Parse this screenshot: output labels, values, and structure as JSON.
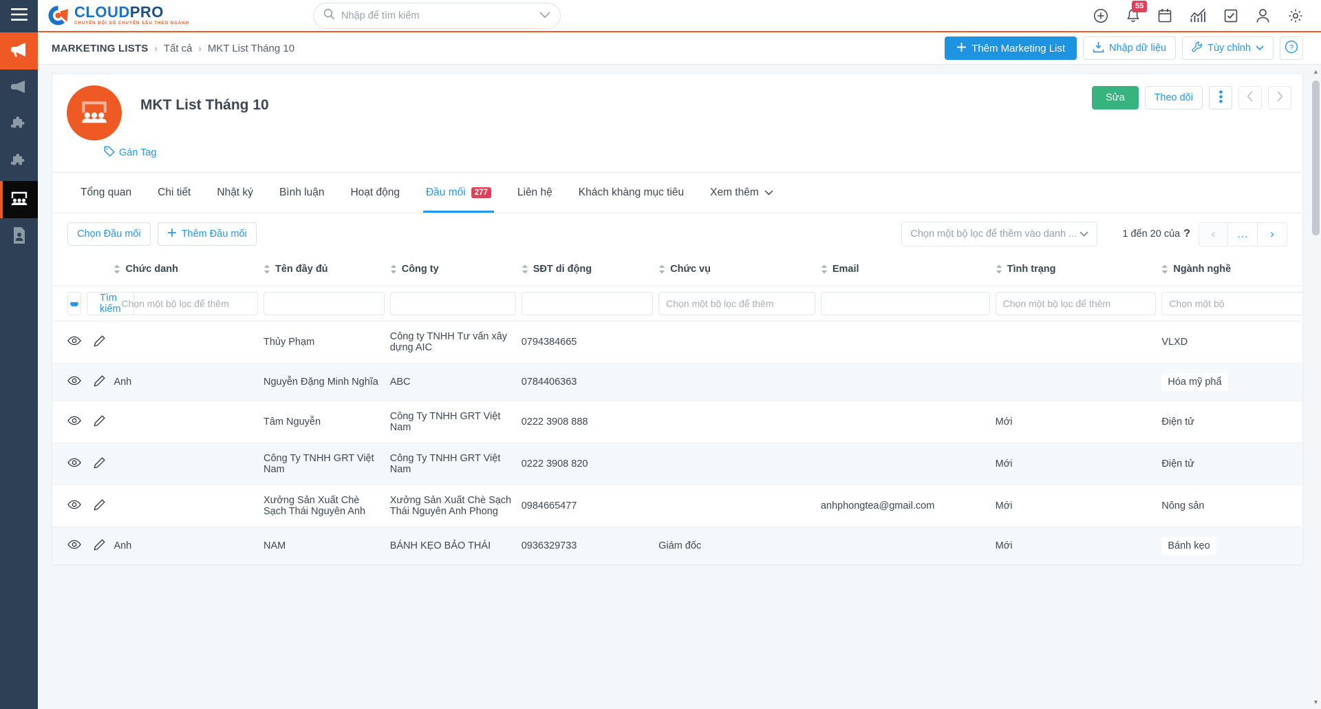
{
  "topbar": {
    "logo_title": "CLOUD",
    "logo_title_pro": "PRO",
    "logo_sub": "CHUYỂN ĐỔI SỐ CHUYÊN SÂU THEO NGÀNH",
    "search_placeholder": "Nhập để tìm kiếm",
    "search_value": "",
    "icons": [
      {
        "name": "plus-circle-icon",
        "label": ""
      },
      {
        "name": "bell-icon",
        "label": "",
        "badge": "55"
      },
      {
        "name": "calendar-icon",
        "label": ""
      },
      {
        "name": "analytics-icon",
        "label": ""
      },
      {
        "name": "task-check-icon",
        "label": ""
      },
      {
        "name": "user-icon",
        "label": ""
      },
      {
        "name": "gear-icon",
        "label": ""
      }
    ]
  },
  "rail": {
    "menu_icon": "hamburger-icon",
    "items": [
      {
        "name": "campaign",
        "icon": "megaphone-icon",
        "state": "active-orange"
      },
      {
        "name": "campaign-list",
        "icon": "megaphone-outline-icon",
        "state": ""
      },
      {
        "name": "module-a",
        "icon": "puzzle-icon",
        "state": ""
      },
      {
        "name": "module-b",
        "icon": "puzzle-icon",
        "state": ""
      },
      {
        "name": "marketing-lists",
        "icon": "people-board-icon",
        "state": "active-dark"
      },
      {
        "name": "documents",
        "icon": "document-person-icon",
        "state": ""
      }
    ]
  },
  "breadcrumb": {
    "root": "MARKETING LISTS",
    "sep": "›",
    "level2": "Tất cả",
    "level3": "MKT List Tháng 10"
  },
  "header_actions": {
    "add_label": "Thêm Marketing List",
    "import_label": "Nhập dữ liệu",
    "customize_label": "Tùy chỉnh",
    "help_label": "?"
  },
  "record": {
    "title": "MKT List Tháng 10",
    "avatar_icon": "people-board-icon",
    "tag_label": "Gán Tag",
    "edit_label": "Sửa",
    "follow_label": "Theo dõi",
    "more_label": "⋮",
    "prev_label": "‹",
    "next_label": "›"
  },
  "tabs": [
    {
      "label": "Tổng quan",
      "active": false
    },
    {
      "label": "Chi tiết",
      "active": false
    },
    {
      "label": "Nhật ký",
      "active": false
    },
    {
      "label": "Bình luận",
      "active": false
    },
    {
      "label": "Hoạt động",
      "active": false
    },
    {
      "label": "Đầu mối",
      "count": "277",
      "active": true
    },
    {
      "label": "Liên hệ",
      "active": false
    },
    {
      "label": "Khách khàng mục tiêu",
      "active": false
    },
    {
      "label": "Xem thêm",
      "chevron": true,
      "active": false
    }
  ],
  "grid_toolbar": {
    "select_label": "Chọn Đầu mối",
    "add_label": "Thêm Đầu mối",
    "filter_placeholder": "Chọn một bộ lọc để thêm vào danh ...",
    "pager_text": "1 đến 20 của",
    "pager_unknown": "?",
    "pager_prev": "‹",
    "pager_more": "…",
    "pager_next": "›"
  },
  "table": {
    "columns": [
      {
        "key": "icons",
        "label": "",
        "sortable": false
      },
      {
        "key": "chuc_danh",
        "label": "Chức danh",
        "sortable": true
      },
      {
        "key": "ten",
        "label": "Tên đầy đủ",
        "sortable": true
      },
      {
        "key": "cong_ty",
        "label": "Công ty",
        "sortable": true
      },
      {
        "key": "sdt",
        "label": "SĐT di động",
        "sortable": true
      },
      {
        "key": "chuc_vu",
        "label": "Chức vụ",
        "sortable": true
      },
      {
        "key": "email",
        "label": "Email",
        "sortable": true
      },
      {
        "key": "tinh_trang",
        "label": "Tình trạng",
        "sortable": true
      },
      {
        "key": "nganh",
        "label": "Ngành nghề",
        "sortable": true
      }
    ],
    "filter_row": {
      "clear_icon": "eraser-icon",
      "search_label": "Tìm kiếm",
      "chuc_danh": "Chọn một bộ lọc để thêm",
      "ten": "",
      "cong_ty": "",
      "sdt": "",
      "chuc_vu": "Chọn một bộ lọc để thêm",
      "email": "",
      "tinh_trang": "Chọn một bộ lọc để thêm",
      "nganh": "Chọn một bộ"
    },
    "rows": [
      {
        "chuc_danh": "",
        "ten": "Thủy Phạm",
        "cong_ty": "Công ty TNHH Tư vấn xây dựng AIC",
        "sdt": "0794384665",
        "chuc_vu": "",
        "email": "",
        "tinh_trang": "",
        "nganh": "VLXD",
        "nganh_chip": false
      },
      {
        "chuc_danh": "Anh",
        "ten": "Nguyễn Đặng Minh Nghĩa",
        "cong_ty": "ABC",
        "sdt": "0784406363",
        "chuc_vu": "",
        "email": "",
        "tinh_trang": "",
        "nganh": "Hóa mỹ phẩ",
        "nganh_chip": true
      },
      {
        "chuc_danh": "",
        "ten": "Tâm Nguyễn",
        "cong_ty": "Công Ty TNHH GRT Việt Nam",
        "sdt": "0222 3908 888",
        "chuc_vu": "",
        "email": "",
        "tinh_trang": "Mới",
        "nganh": "Điện tử",
        "nganh_chip": false
      },
      {
        "chuc_danh": "",
        "ten": "Công Ty TNHH GRT Việt Nam",
        "cong_ty": "Công Ty TNHH GRT Việt Nam",
        "sdt": "0222 3908 820",
        "chuc_vu": "",
        "email": "",
        "tinh_trang": "Mới",
        "nganh": "Điện tử",
        "nganh_chip": false
      },
      {
        "chuc_danh": "",
        "ten": "Xưởng Sản Xuất Chè Sạch Thái Nguyên Anh",
        "cong_ty": "Xưởng Sản Xuất Chè Sạch Thái Nguyên Anh Phong",
        "sdt": "0984665477",
        "chuc_vu": "",
        "email": "anhphongtea@gmail.com",
        "tinh_trang": "Mới",
        "nganh": "Nông sản",
        "nganh_chip": false
      },
      {
        "chuc_danh": "Anh",
        "ten": "NAM",
        "cong_ty": "BÁNH KẸO BẢO THÁI",
        "sdt": "0936329733",
        "chuc_vu": "Giám đốc",
        "email": "",
        "tinh_trang": "Mới",
        "nganh": "Bánh kẹo",
        "nganh_chip": true
      }
    ]
  },
  "colors": {
    "brand_orange": "#ef5a24",
    "brand_blue": "#1a73c8",
    "accent_blue": "#2196f3",
    "primary_button": "#1e94e0",
    "green": "#36b37e",
    "badge_red": "#e2405a",
    "rail_dark": "#2e4055"
  }
}
